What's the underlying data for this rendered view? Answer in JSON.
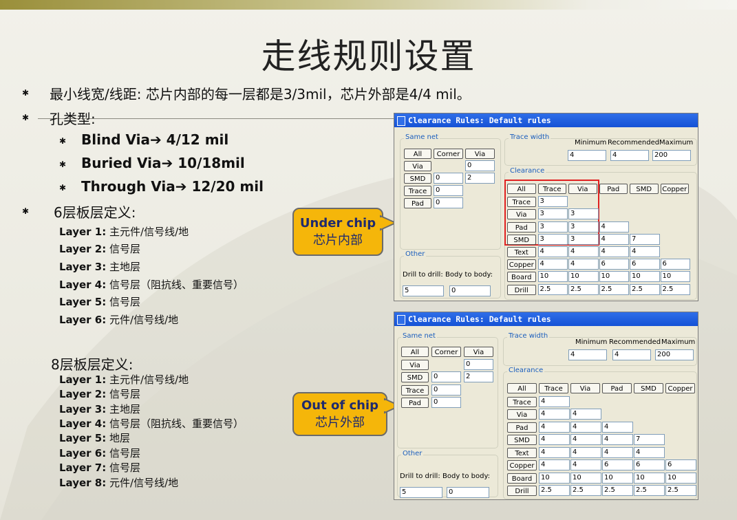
{
  "title": "走线规则设置",
  "bullets": {
    "b1": "最小线宽/线距: 芯片内部的每一层都是3/3mil，芯片外部是4/4 mil。",
    "b2": "孔类型:",
    "sub": [
      "Blind Via➔ 4/12 mil",
      "Buried Via➔ 10/18mil",
      "Through Via➔ 12/20 mil"
    ],
    "b3": "6层板层定义:"
  },
  "layers6": [
    {
      "name": "Layer 1:",
      "desc": "主元件/信号线/地"
    },
    {
      "name": "Layer 2:",
      "desc": "信号层"
    },
    {
      "name": "Layer 3:",
      "desc": "主地层"
    },
    {
      "name": "Layer 4:",
      "desc": "信号层（阻抗线、重要信号）"
    },
    {
      "name": "Layer 5:",
      "desc": "信号层"
    },
    {
      "name": "Layer 6:",
      "desc": "元件/信号线/地"
    }
  ],
  "heading8": "8层板层定义:",
  "layers8": [
    {
      "name": "Layer 1:",
      "desc": "主元件/信号线/地"
    },
    {
      "name": "Layer 2:",
      "desc": "信号层"
    },
    {
      "name": "Layer 3:",
      "desc": "主地层"
    },
    {
      "name": "Layer 4:",
      "desc": "信号层（阻抗线、重要信号）"
    },
    {
      "name": "Layer 5:",
      "desc": "地层"
    },
    {
      "name": "Layer 6:",
      "desc": "信号层"
    },
    {
      "name": "Layer 7:",
      "desc": "信号层"
    },
    {
      "name": "Layer 8:",
      "desc": "元件/信号线/地"
    }
  ],
  "callouts": [
    {
      "line1": "Under chip",
      "line2": "芯片内部"
    },
    {
      "line1": "Out of chip",
      "line2": "芯片外部"
    }
  ],
  "dialogs": [
    {
      "title": "Clearance Rules: Default rules",
      "same_net": "Same net",
      "trace_width": "Trace width",
      "clearance": "Clearance",
      "other": "Other",
      "min_label": "Minimum",
      "rec_label": "Recommended",
      "max_label": "Maximum",
      "tw_min": "4",
      "tw_rec": "4",
      "tw_max": "200",
      "sn_buttons": [
        "All",
        "Corner",
        "Via"
      ],
      "sn_rows": [
        "Via",
        "SMD",
        "Trace",
        "Pad"
      ],
      "sn_values": [
        [
          "",
          "0"
        ],
        [
          "0",
          "2"
        ],
        [
          "0",
          ""
        ],
        [
          "0",
          ""
        ]
      ],
      "cl_cols": [
        "All",
        "Trace",
        "Via",
        "Pad",
        "SMD",
        "Copper"
      ],
      "cl_rows": [
        "Trace",
        "Via",
        "Pad",
        "SMD",
        "Text",
        "Copper",
        "Board",
        "Drill"
      ],
      "cl_values": [
        [
          "3"
        ],
        [
          "3",
          "3"
        ],
        [
          "3",
          "3",
          "4"
        ],
        [
          "3",
          "3",
          "4",
          "7"
        ],
        [
          "4",
          "4",
          "4",
          "4"
        ],
        [
          "4",
          "4",
          "6",
          "6",
          "6"
        ],
        [
          "10",
          "10",
          "10",
          "10",
          "10"
        ],
        [
          "2.5",
          "2.5",
          "2.5",
          "2.5",
          "2.5"
        ]
      ],
      "drill_to_drill": "Drill to drill:",
      "body_to_body": "Body to body:",
      "d2d": "5",
      "b2b": "0"
    },
    {
      "title": "Clearance Rules: Default rules",
      "same_net": "Same net",
      "trace_width": "Trace width",
      "clearance": "Clearance",
      "other": "Other",
      "min_label": "Minimum",
      "rec_label": "Recommended",
      "max_label": "Maximum",
      "tw_min": "4",
      "tw_rec": "4",
      "tw_max": "200",
      "sn_buttons": [
        "All",
        "Corner",
        "Via"
      ],
      "sn_rows": [
        "Via",
        "SMD",
        "Trace",
        "Pad"
      ],
      "sn_values": [
        [
          "",
          "0"
        ],
        [
          "0",
          "2"
        ],
        [
          "0",
          ""
        ],
        [
          "0",
          ""
        ]
      ],
      "cl_cols": [
        "All",
        "Trace",
        "Via",
        "Pad",
        "SMD",
        "Copper"
      ],
      "cl_rows": [
        "Trace",
        "Via",
        "Pad",
        "SMD",
        "Text",
        "Copper",
        "Board",
        "Drill"
      ],
      "cl_values": [
        [
          "4"
        ],
        [
          "4",
          "4"
        ],
        [
          "4",
          "4",
          "4"
        ],
        [
          "4",
          "4",
          "4",
          "7"
        ],
        [
          "4",
          "4",
          "4",
          "4"
        ],
        [
          "4",
          "4",
          "6",
          "6",
          "6"
        ],
        [
          "10",
          "10",
          "10",
          "10",
          "10"
        ],
        [
          "2.5",
          "2.5",
          "2.5",
          "2.5",
          "2.5"
        ]
      ],
      "drill_to_drill": "Drill to drill:",
      "body_to_body": "Body to body:",
      "d2d": "5",
      "b2b": "0"
    }
  ]
}
